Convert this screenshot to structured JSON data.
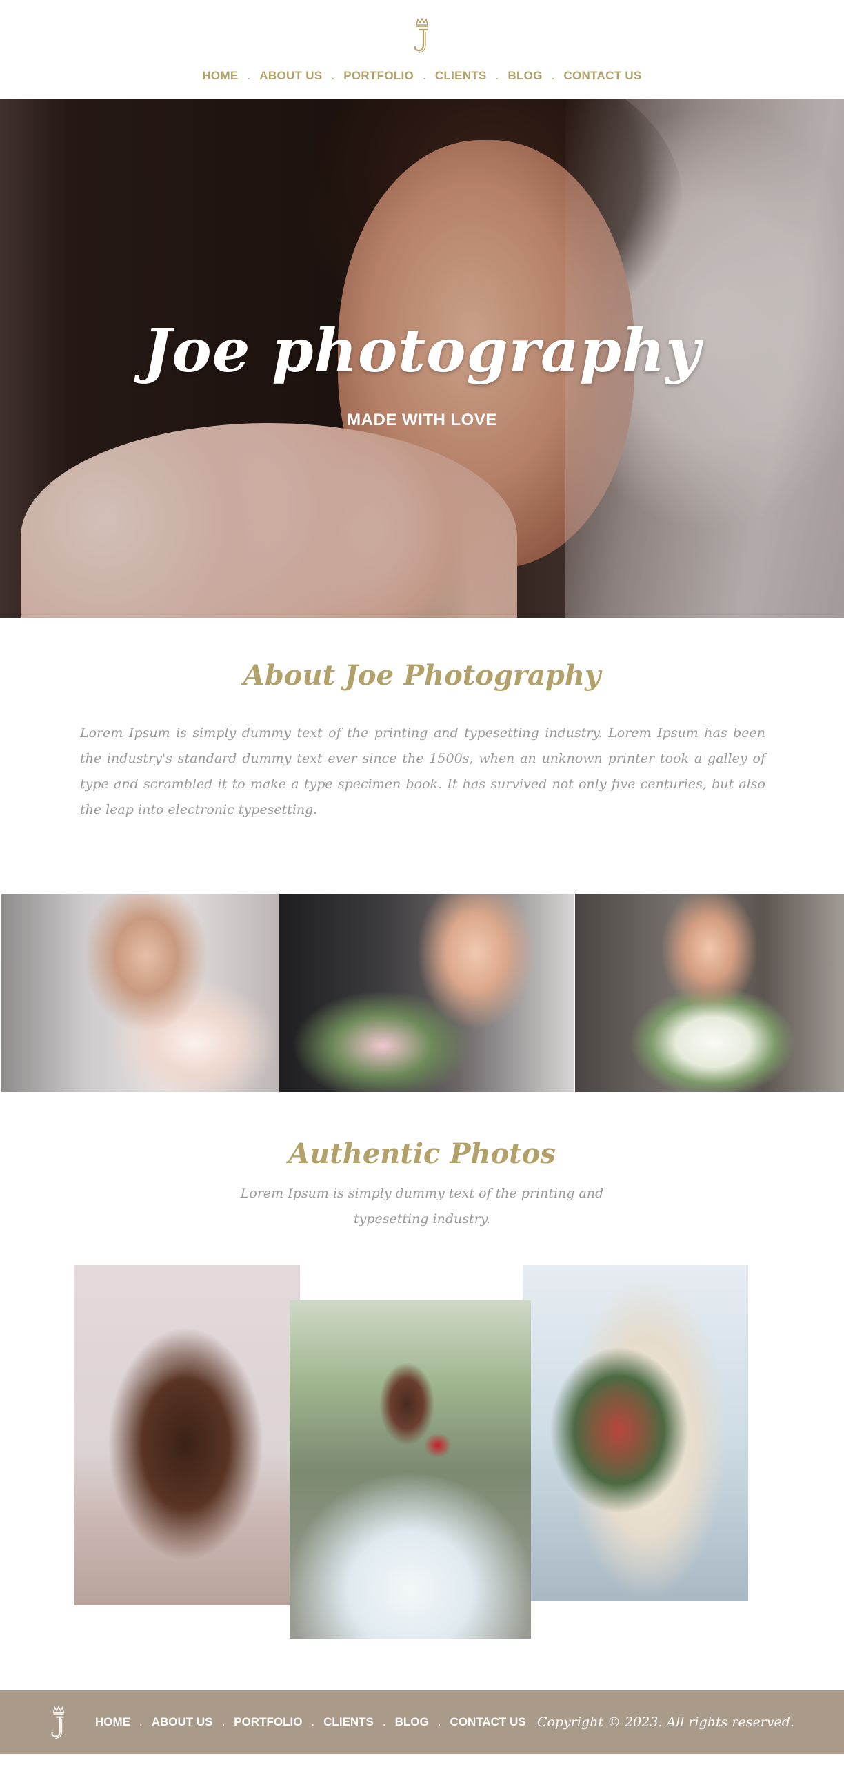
{
  "brand": {
    "logo_icon": "crown-j-monogram-icon",
    "accent": "#b3a16a",
    "footer_bg": "#a99a89"
  },
  "nav": {
    "items": [
      {
        "label": "HOME"
      },
      {
        "label": "ABOUT US"
      },
      {
        "label": "PORTFOLIO"
      },
      {
        "label": "CLIENTS"
      },
      {
        "label": "BLOG"
      },
      {
        "label": "CONTACT US"
      }
    ],
    "separator": "."
  },
  "hero": {
    "title": "Joe photography",
    "subtitle": "MADE WITH LOVE"
  },
  "about": {
    "title": "About Joe Photography",
    "text": "Lorem Ipsum is simply dummy text of the printing and typesetting industry. Lorem Ipsum has been the industry's standard dummy text ever since the 1500s, when an unknown printer took a galley of type and scrambled it to make a type specimen book. It has survived not only five centuries, but also the leap into electronic typesetting."
  },
  "authentic": {
    "title": "Authentic Photos",
    "text": "Lorem Ipsum is simply dummy text of the printing and typesetting industry."
  },
  "footer": {
    "copyright": "Copyright © 2023. All rights reserved."
  }
}
